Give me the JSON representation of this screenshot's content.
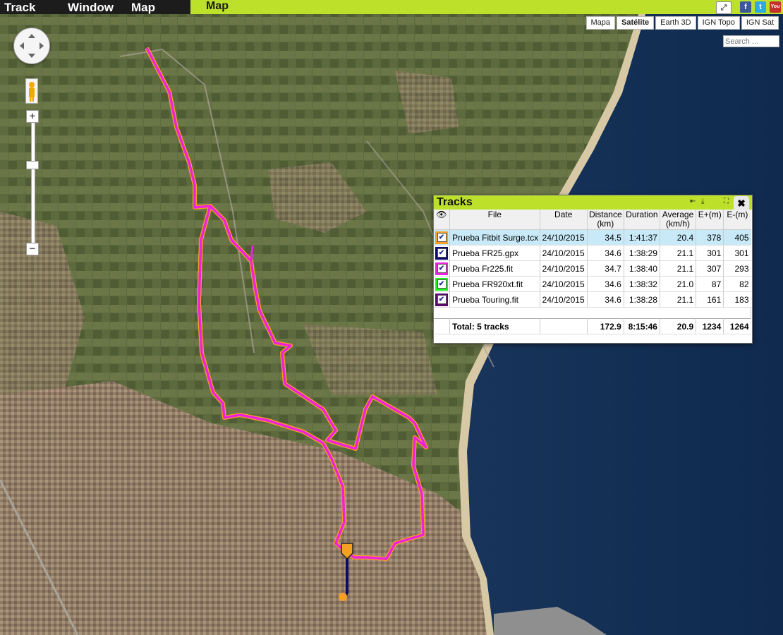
{
  "menu": {
    "track": "Track",
    "window": "Window",
    "map": "Map"
  },
  "map_title": "Map",
  "top_icons": {
    "facebook": "f",
    "twitter": "t",
    "youtube": "You"
  },
  "map_types": [
    "Mapa",
    "Satélite",
    "Earth 3D",
    "IGN Topo",
    "IGN Sat"
  ],
  "search": {
    "placeholder": "Search ..."
  },
  "zoom": {
    "plus": "+",
    "minus": "−"
  },
  "tracks_panel": {
    "title": "Tracks",
    "columns": {
      "file": "File",
      "date": "Date",
      "distance": "Distance",
      "distance_unit": "(km)",
      "duration": "Duration",
      "average": "Average",
      "average_unit": "(km/h)",
      "eplus": "E+(m)",
      "eminus": "E-(m)"
    },
    "rows": [
      {
        "color": "#f5a020",
        "file": "Prueba Fitbit Surge.tcx",
        "date": "24/10/2015",
        "distance": "34.5",
        "duration": "1:41:37",
        "average": "20.4",
        "eplus": "378",
        "eminus": "405"
      },
      {
        "color": "#0a0a6a",
        "file": "Prueba FR25.gpx",
        "date": "24/10/2015",
        "distance": "34.6",
        "duration": "1:38:29",
        "average": "21.1",
        "eplus": "301",
        "eminus": "301"
      },
      {
        "color": "#ee22dd",
        "file": "Prueba Fr225.fit",
        "date": "24/10/2015",
        "distance": "34.7",
        "duration": "1:38:40",
        "average": "21.1",
        "eplus": "307",
        "eminus": "293"
      },
      {
        "color": "#22ee22",
        "file": "Prueba FR920xt.fit",
        "date": "24/10/2015",
        "distance": "34.6",
        "duration": "1:38:32",
        "average": "21.0",
        "eplus": "87",
        "eminus": "82"
      },
      {
        "color": "#5a0a6a",
        "file": "Prueba Touring.fit",
        "date": "24/10/2015",
        "distance": "34.6",
        "duration": "1:38:28",
        "average": "21.1",
        "eplus": "161",
        "eminus": "183"
      }
    ],
    "total": {
      "label": "Total: 5 tracks",
      "distance": "172.9",
      "duration": "8:15:46",
      "average": "20.9",
      "eplus": "1234",
      "eminus": "1264"
    }
  },
  "colors": {
    "accent": "#bde02a",
    "route": "#ee22dd",
    "route_alt": "#f5a020",
    "route_dark": "#0a0a6a"
  }
}
